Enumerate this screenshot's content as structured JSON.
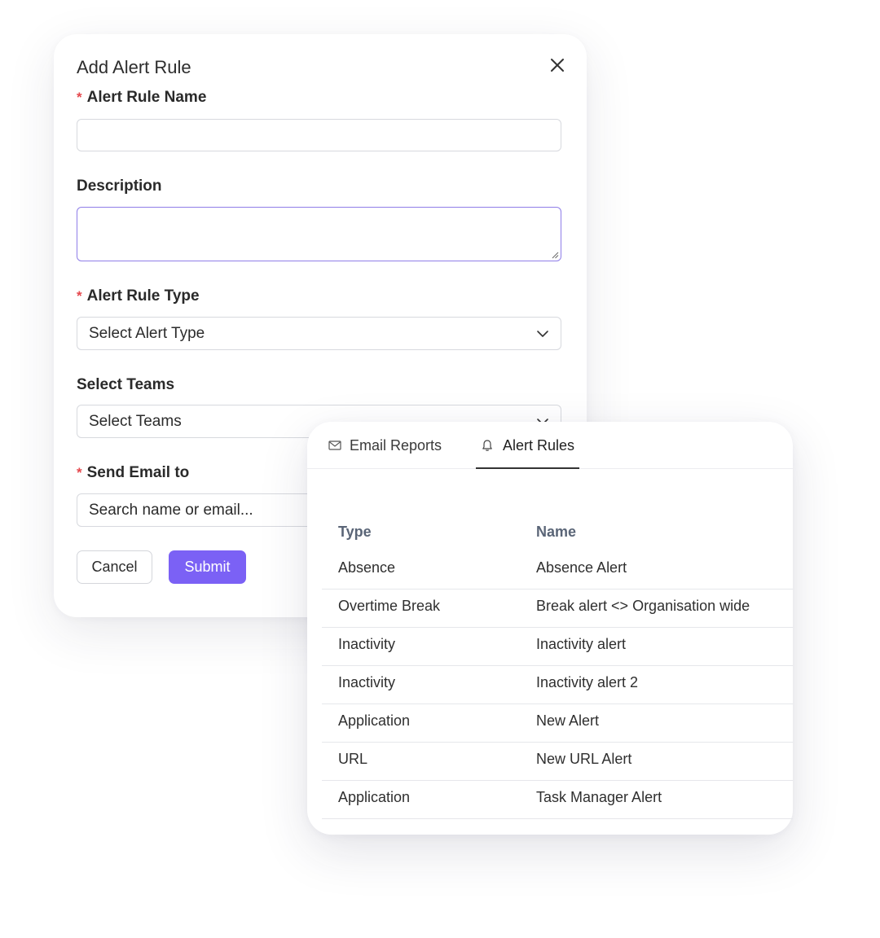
{
  "modal": {
    "title": "Add Alert Rule",
    "fields": {
      "alert_rule_name": {
        "label": "Alert Rule Name",
        "required_marker": "*",
        "value": ""
      },
      "description": {
        "label": "Description",
        "value": ""
      },
      "alert_rule_type": {
        "label": "Alert Rule Type",
        "required_marker": "*",
        "selected": "Select Alert Type"
      },
      "select_teams": {
        "label": "Select Teams",
        "selected": "Select Teams"
      },
      "send_email_to": {
        "label": "Send Email to",
        "required_marker": "*",
        "placeholder": "Search name or email..."
      }
    },
    "buttons": {
      "cancel": "Cancel",
      "submit": "Submit"
    },
    "icons": {
      "close": "close-icon",
      "dropdown": "chevron-down-icon"
    }
  },
  "alerts_panel": {
    "tabs": [
      {
        "label": "Email Reports",
        "icon": "mail-icon",
        "active": false
      },
      {
        "label": "Alert Rules",
        "icon": "bell-icon",
        "active": true
      }
    ],
    "table": {
      "columns": [
        "Type",
        "Name"
      ],
      "rows": [
        {
          "type": "Absence",
          "name": "Absence Alert"
        },
        {
          "type": "Overtime Break",
          "name": "Break alert <> Organisation wide"
        },
        {
          "type": "Inactivity",
          "name": "Inactivity alert"
        },
        {
          "type": "Inactivity",
          "name": "Inactivity alert 2"
        },
        {
          "type": "Application",
          "name": "New Alert"
        },
        {
          "type": "URL",
          "name": "New URL Alert"
        },
        {
          "type": "Application",
          "name": "Task Manager Alert"
        }
      ]
    }
  },
  "colors": {
    "accent": "#7b61f5",
    "required": "#e5484d",
    "focus_border": "#8f7ee8",
    "header_text": "#5a6577"
  }
}
